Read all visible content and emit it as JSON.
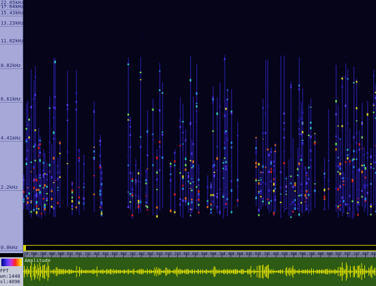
{
  "freq_axis": {
    "labels": [
      "22.05kHz",
      "17.64kHz",
      "15.43kHz",
      "13.23kHz",
      "11.02kHz",
      "8.82kHz",
      "6.61kHz",
      "4.41kHz",
      "2.2kHz",
      "0.0kHz"
    ]
  },
  "time_axis": {
    "labels": [
      "0.0s",
      "0.2s",
      "0.4s",
      "0.6s",
      "0.8s",
      "1.0s",
      "1.2s",
      "1.4s",
      "1.6s",
      "1.8s",
      "2.0s",
      "2.2s",
      "2.4s",
      "2.6s",
      "2.8s",
      "3.0s",
      "3.2s",
      "3.4s",
      "3.6s",
      "3.8s",
      "4.0s",
      "4.2s",
      "4.4s",
      "4.6s",
      "4.8s",
      "5.0s",
      "5.2s",
      "5.4s",
      "5.6s",
      "5.8s",
      "6.0s",
      "6.2s",
      "6.4s",
      "6.6s",
      "6.8s",
      "7.0s",
      "7.2s",
      "7.4s",
      "7.6s",
      "7.8s"
    ]
  },
  "legend": {
    "mode": "FFT",
    "window": "wn:1440",
    "size": "sl:4096"
  },
  "waveform": {
    "label": "Amplitude"
  },
  "colors": {
    "spectrogram_bg": "#050419",
    "waveform_bg": "#2d5a14",
    "waveform_trace": "#e0e000",
    "axis_bg": "#a6a9d8"
  }
}
